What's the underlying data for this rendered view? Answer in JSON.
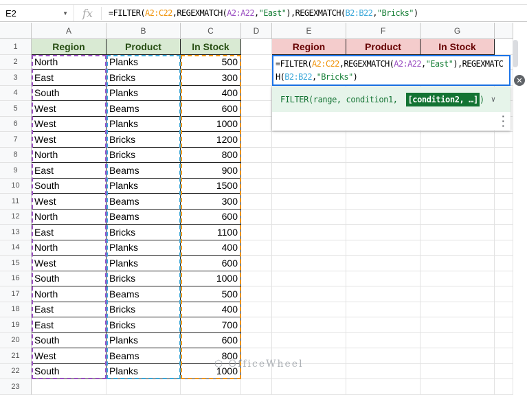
{
  "formula_bar": {
    "cell_ref": "E2",
    "fx": "fx",
    "formula_parts": [
      {
        "t": "=FILTER(",
        "c": ""
      },
      {
        "t": "A2:C22",
        "c": "r1"
      },
      {
        "t": ",REGEXMATCH(",
        "c": ""
      },
      {
        "t": "A2:A22",
        "c": "r2"
      },
      {
        "t": ",",
        "c": ""
      },
      {
        "t": "\"East\"",
        "c": "s"
      },
      {
        "t": "),REGEXMATCH(",
        "c": ""
      },
      {
        "t": "B2:B22",
        "c": "r3"
      },
      {
        "t": ",",
        "c": ""
      },
      {
        "t": "\"Bricks\"",
        "c": "s"
      },
      {
        "t": ")",
        "c": ""
      }
    ]
  },
  "columns": [
    "A",
    "B",
    "C",
    "D",
    "E",
    "F",
    "G"
  ],
  "source_headers": [
    "Region",
    "Product",
    "In Stock"
  ],
  "result_headers": [
    "Region",
    "Product",
    "In Stock"
  ],
  "rows": [
    [
      "North",
      "Planks",
      "500"
    ],
    [
      "East",
      "Bricks",
      "300"
    ],
    [
      "South",
      "Planks",
      "400"
    ],
    [
      "West",
      "Beams",
      "600"
    ],
    [
      "West",
      "Planks",
      "1000"
    ],
    [
      "West",
      "Bricks",
      "1200"
    ],
    [
      "North",
      "Bricks",
      "800"
    ],
    [
      "East",
      "Beams",
      "900"
    ],
    [
      "South",
      "Planks",
      "1500"
    ],
    [
      "West",
      "Beams",
      "300"
    ],
    [
      "North",
      "Beams",
      "600"
    ],
    [
      "East",
      "Bricks",
      "1100"
    ],
    [
      "North",
      "Planks",
      "400"
    ],
    [
      "West",
      "Planks",
      "600"
    ],
    [
      "South",
      "Bricks",
      "1000"
    ],
    [
      "North",
      "Beams",
      "500"
    ],
    [
      "East",
      "Bricks",
      "400"
    ],
    [
      "East",
      "Bricks",
      "700"
    ],
    [
      "South",
      "Planks",
      "600"
    ],
    [
      "West",
      "Beams",
      "800"
    ],
    [
      "South",
      "Planks",
      "1000"
    ]
  ],
  "row_numbers": [
    "1",
    "2",
    "3",
    "4",
    "5",
    "6",
    "7",
    "8",
    "9",
    "10",
    "11",
    "12",
    "13",
    "14",
    "15",
    "16",
    "17",
    "18",
    "19",
    "20",
    "21",
    "22",
    "23"
  ],
  "helper": {
    "signature": "FILTER(range, condition1, ",
    "highlight": "[condition2, …]",
    "close": ")",
    "expand_icon": "chevron-down-icon",
    "more_icon": "more-vert-icon"
  },
  "watermark": "OfficeWheel",
  "colors": {
    "source_header_bg": "#d9ead3",
    "result_header_bg": "#f4cccc",
    "active_border": "#1a73e8"
  }
}
